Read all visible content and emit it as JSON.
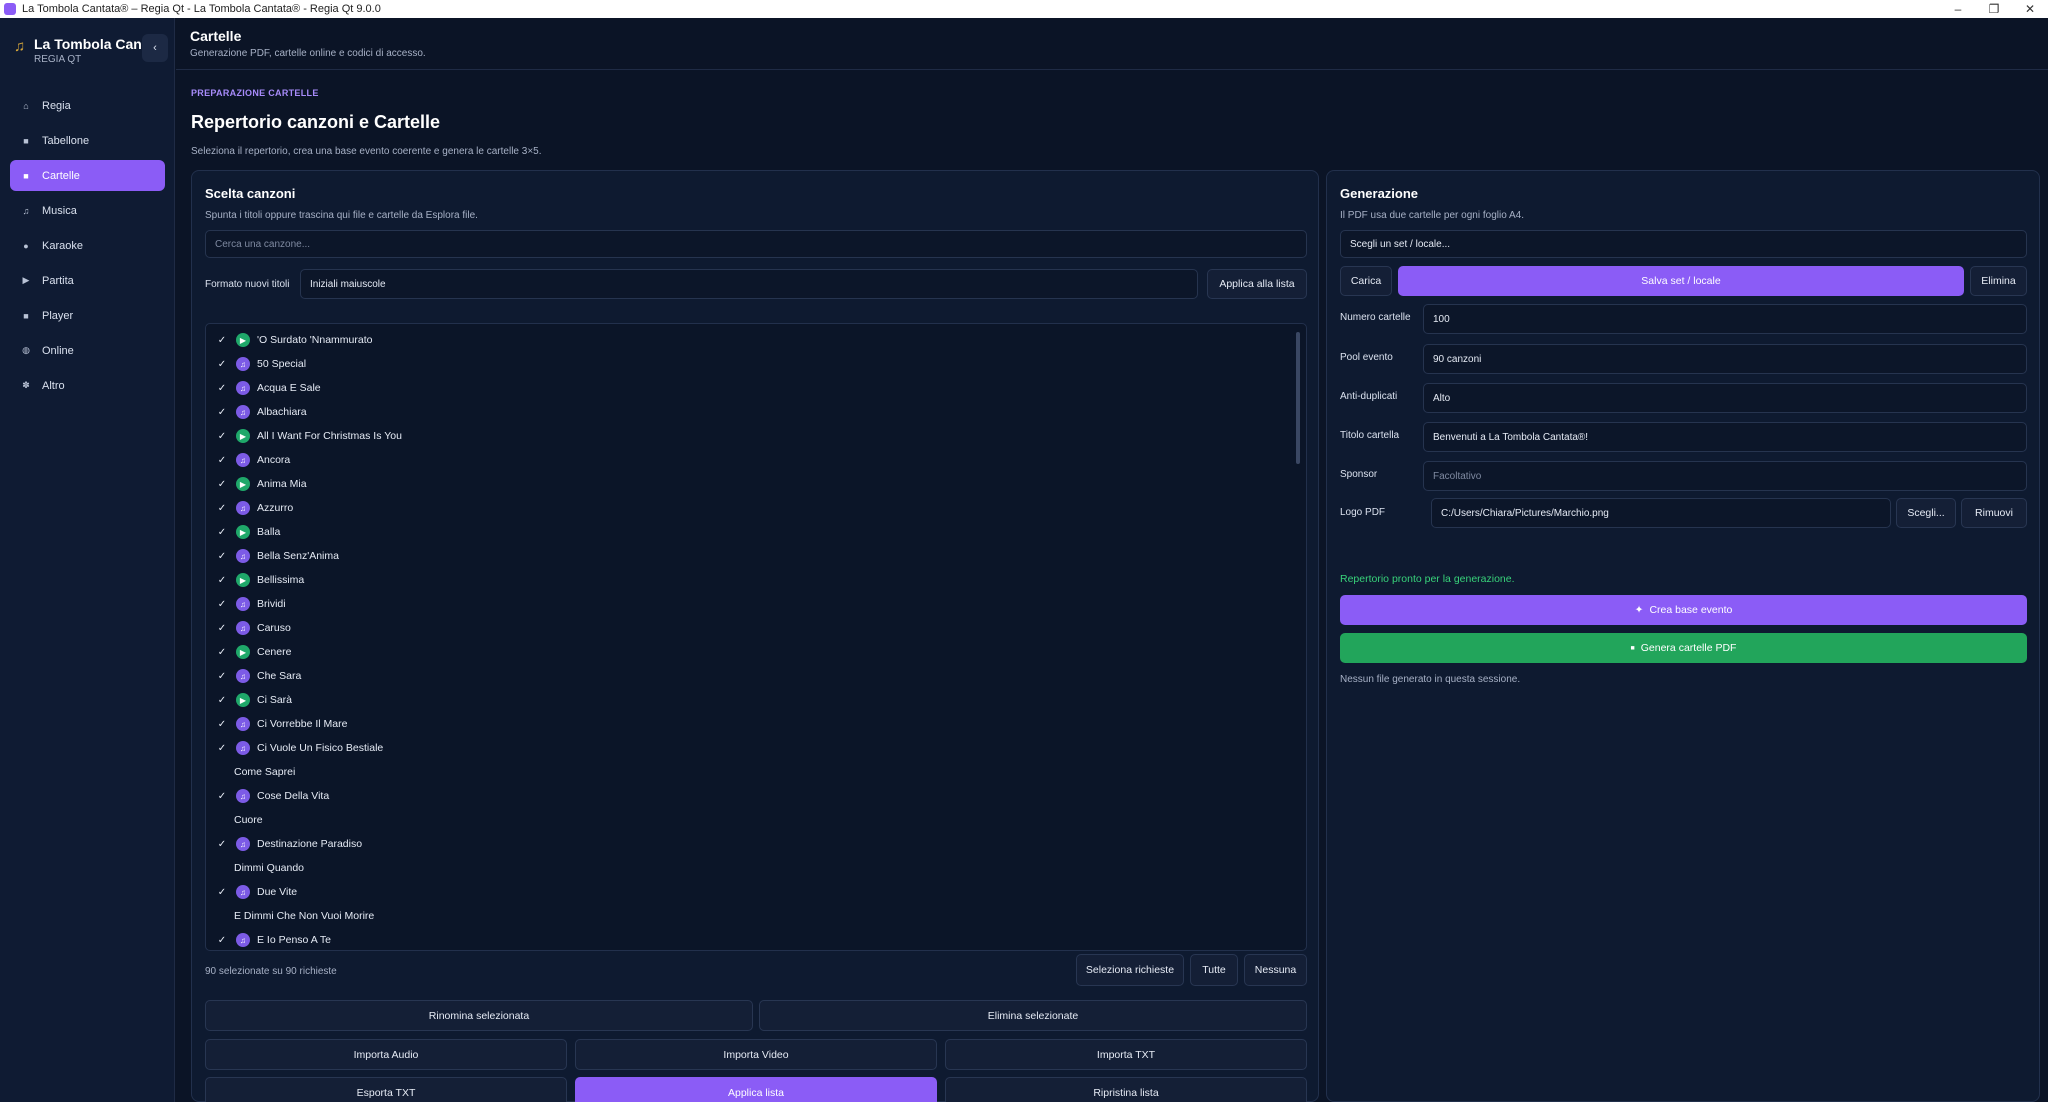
{
  "window": {
    "title": "La Tombola Cantata® – Regia Qt - La Tombola Cantata® - Regia Qt 9.0.0",
    "controls": [
      "–",
      "❐",
      "✕"
    ]
  },
  "sidebar": {
    "app_name": "La Tombola Cantata",
    "app_sub": "REGIA QT",
    "collapse_glyph": "‹",
    "items": [
      {
        "label": "Regia",
        "glyph": "⌂",
        "icon": "home-icon"
      },
      {
        "label": "Tabellone",
        "glyph": "■",
        "icon": "board-icon"
      },
      {
        "label": "Cartelle",
        "glyph": "■",
        "icon": "cards-icon",
        "active": true
      },
      {
        "label": "Musica",
        "glyph": "♫",
        "icon": "music-icon"
      },
      {
        "label": "Karaoke",
        "glyph": "●",
        "icon": "mic-icon"
      },
      {
        "label": "Partita",
        "glyph": "▶",
        "icon": "play-icon"
      },
      {
        "label": "Player",
        "glyph": "■",
        "icon": "player-icon"
      },
      {
        "label": "Online",
        "glyph": "◍",
        "icon": "globe-icon"
      },
      {
        "label": "Altro",
        "glyph": "✽",
        "icon": "gear-icon"
      }
    ]
  },
  "header": {
    "title": "Cartelle",
    "subtitle": "Generazione PDF, cartelle online e codici di accesso."
  },
  "section": {
    "kicker": "PREPARAZIONE CARTELLE",
    "title": "Repertorio canzoni e Cartelle",
    "lead": "Seleziona il repertorio, crea una base evento coerente e genera le cartelle 3×5."
  },
  "songs_panel": {
    "title": "Scelta canzoni",
    "desc": "Spunta i titoli oppure trascina qui file e cartelle da Esplora file.",
    "search_placeholder": "Cerca una canzone...",
    "format_label": "Formato nuovi titoli",
    "format_value": "Iniziali maiuscole",
    "apply_format": "Applica alla lista",
    "check_glyph": "✓",
    "audio_glyph": "♫",
    "video_glyph": "▶",
    "songs": [
      {
        "title": "'O Surdato 'Nnammurato",
        "checked": true,
        "type": "video"
      },
      {
        "title": "50 Special",
        "checked": true,
        "type": "audio"
      },
      {
        "title": "Acqua E Sale",
        "checked": true,
        "type": "audio"
      },
      {
        "title": "Albachiara",
        "checked": true,
        "type": "audio"
      },
      {
        "title": "All I Want For Christmas Is You",
        "checked": true,
        "type": "video"
      },
      {
        "title": "Ancora",
        "checked": true,
        "type": "audio"
      },
      {
        "title": "Anima Mia",
        "checked": true,
        "type": "video"
      },
      {
        "title": "Azzurro",
        "checked": true,
        "type": "audio"
      },
      {
        "title": "Balla",
        "checked": true,
        "type": "video"
      },
      {
        "title": "Bella Senz'Anima",
        "checked": true,
        "type": "audio"
      },
      {
        "title": "Bellissima",
        "checked": true,
        "type": "video"
      },
      {
        "title": "Brividi",
        "checked": true,
        "type": "audio"
      },
      {
        "title": "Caruso",
        "checked": true,
        "type": "audio"
      },
      {
        "title": "Cenere",
        "checked": true,
        "type": "video"
      },
      {
        "title": "Che Sara",
        "checked": true,
        "type": "audio"
      },
      {
        "title": "Ci Sarà",
        "checked": true,
        "type": "video"
      },
      {
        "title": "Ci Vorrebbe Il Mare",
        "checked": true,
        "type": "audio"
      },
      {
        "title": "Ci Vuole Un Fisico Bestiale",
        "checked": true,
        "type": "audio"
      },
      {
        "title": "Come Saprei",
        "checked": false,
        "type": "none"
      },
      {
        "title": "Cose Della Vita",
        "checked": true,
        "type": "audio"
      },
      {
        "title": "Cuore",
        "checked": false,
        "type": "none"
      },
      {
        "title": "Destinazione Paradiso",
        "checked": true,
        "type": "audio"
      },
      {
        "title": "Dimmi Quando",
        "checked": false,
        "type": "none"
      },
      {
        "title": "Due Vite",
        "checked": true,
        "type": "audio"
      },
      {
        "title": "E Dimmi Che Non Vuoi Morire",
        "checked": false,
        "type": "none"
      },
      {
        "title": "E Io Penso A Te",
        "checked": true,
        "type": "audio"
      }
    ],
    "selection_count": "90 selezionate su 90 richieste",
    "select_requested": "Seleziona richieste",
    "select_all": "Tutte",
    "select_none": "Nessuna",
    "rename_selected": "Rinomina selezionata",
    "delete_selected": "Elimina selezionate",
    "import_audio": "Importa Audio",
    "import_video": "Importa Video",
    "import_txt": "Importa TXT",
    "export_txt": "Esporta TXT",
    "apply_list": "Applica lista",
    "reset_list": "Ripristina lista"
  },
  "generation_panel": {
    "title": "Generazione",
    "desc": "Il PDF usa due cartelle per ogni foglio A4.",
    "set_placeholder": "Scegli un set / locale...",
    "load": "Carica",
    "save_set": "Salva set / locale",
    "delete": "Elimina",
    "fields": {
      "num_cards_label": "Numero cartelle",
      "num_cards_value": "100",
      "pool_label": "Pool evento",
      "pool_value": "90 canzoni",
      "antidup_label": "Anti-duplicati",
      "antidup_value": "Alto",
      "card_title_label": "Titolo cartella",
      "card_title_value": "Benvenuti a La Tombola Cantata®!",
      "sponsor_label": "Sponsor",
      "sponsor_placeholder": "Facoltativo",
      "logo_label": "Logo PDF",
      "logo_value": "C:/Users/Chiara/Pictures/Marchio.png"
    },
    "choose": "Scegli...",
    "remove": "Rimuovi",
    "status_ready": "Repertorio pronto per la generazione.",
    "create_base": "Crea base evento",
    "create_base_glyph": "✦",
    "generate_pdf": "Genera cartelle PDF",
    "generate_pdf_glyph": "■",
    "status_files": "Nessun file generato in questa sessione."
  },
  "colors": {
    "accent": "#8b5cf6",
    "success": "#22a55b",
    "background": "#0b1426"
  }
}
